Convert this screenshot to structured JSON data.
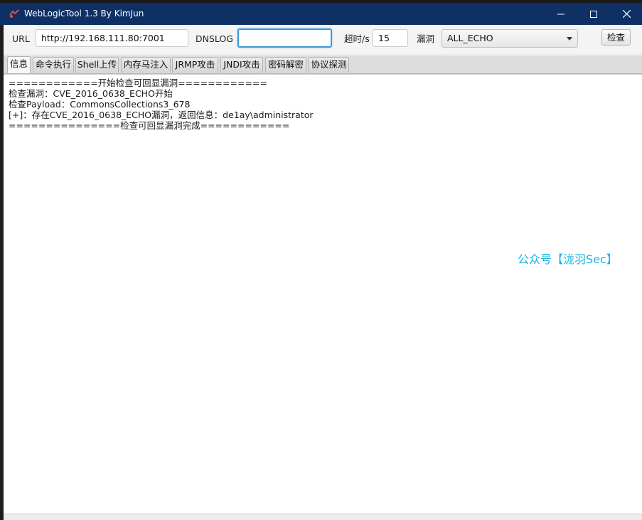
{
  "window": {
    "title": "WebLogicTool 1.3 By KimJun",
    "controls": {
      "minimize": "minimize-icon",
      "maximize": "maximize-icon",
      "close": "close-icon"
    }
  },
  "toolbar": {
    "url_label": "URL",
    "url_value": "http://192.168.111.80:7001",
    "dnslog_label": "DNSLOG",
    "dnslog_value": "",
    "timeout_label": "超时/s",
    "timeout_value": "15",
    "vuln_label": "漏洞",
    "vuln_selected": "ALL_ECHO",
    "check_button": "检查"
  },
  "tabs": [
    {
      "label": "信息",
      "active": true
    },
    {
      "label": "命令执行",
      "active": false
    },
    {
      "label": "Shell上传",
      "active": false
    },
    {
      "label": "内存马注入",
      "active": false
    },
    {
      "label": "JRMP攻击",
      "active": false
    },
    {
      "label": "JNDI攻击",
      "active": false
    },
    {
      "label": "密码解密",
      "active": false
    },
    {
      "label": "协议探测",
      "active": false
    }
  ],
  "output": {
    "lines": [
      "============开始检查可回显漏洞============",
      "检查漏洞：CVE_2016_0638_ECHO开始",
      "检查Payload：CommonsCollections3_678",
      "[+]：存在CVE_2016_0638_ECHO漏洞，返回信息：de1ay\\administrator",
      "===============检查可回显漏洞完成============"
    ]
  },
  "watermark": "公众号【泷羽Sec】",
  "colors": {
    "titlebar": "#0f3064",
    "focus_border": "#3d9ad8",
    "watermark": "#19b5e6"
  }
}
